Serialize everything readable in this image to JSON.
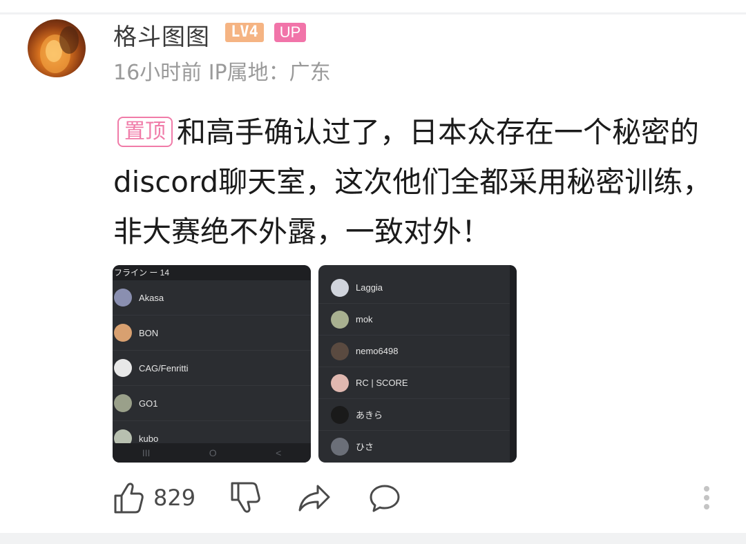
{
  "post": {
    "username": "格斗图图",
    "level_badge": "LV4",
    "role_badge": "UP",
    "meta": "16小时前 IP属地：广东",
    "pin_label": "置顶",
    "text_line1": "和高手确认过了，日本众存在一个秘密的",
    "text_line2": "discord聊天室，这次他们全都采用秘密训练，",
    "text_line3": "非大赛绝不外露，一致对外！"
  },
  "screenshot1": {
    "header": "フライン ー 14",
    "members": [
      "Akasa",
      "BON",
      "CAG/Fenritti",
      "GO1",
      "kubo"
    ],
    "navbar": [
      "III",
      "O",
      "<"
    ]
  },
  "screenshot2": {
    "members": [
      "Laggia",
      "mok",
      "nemo6498",
      "RC | SCORE",
      "あきら",
      "ひさ"
    ]
  },
  "actions": {
    "like_count": "829",
    "icons": [
      "thumb-up-icon",
      "thumb-down-icon",
      "share-icon",
      "comment-icon",
      "more-icon"
    ]
  },
  "colors": {
    "level_badge": "#f5b483",
    "up_badge": "#f174a9",
    "pin": "#f07ba8",
    "discord_bg": "#2b2d31"
  }
}
